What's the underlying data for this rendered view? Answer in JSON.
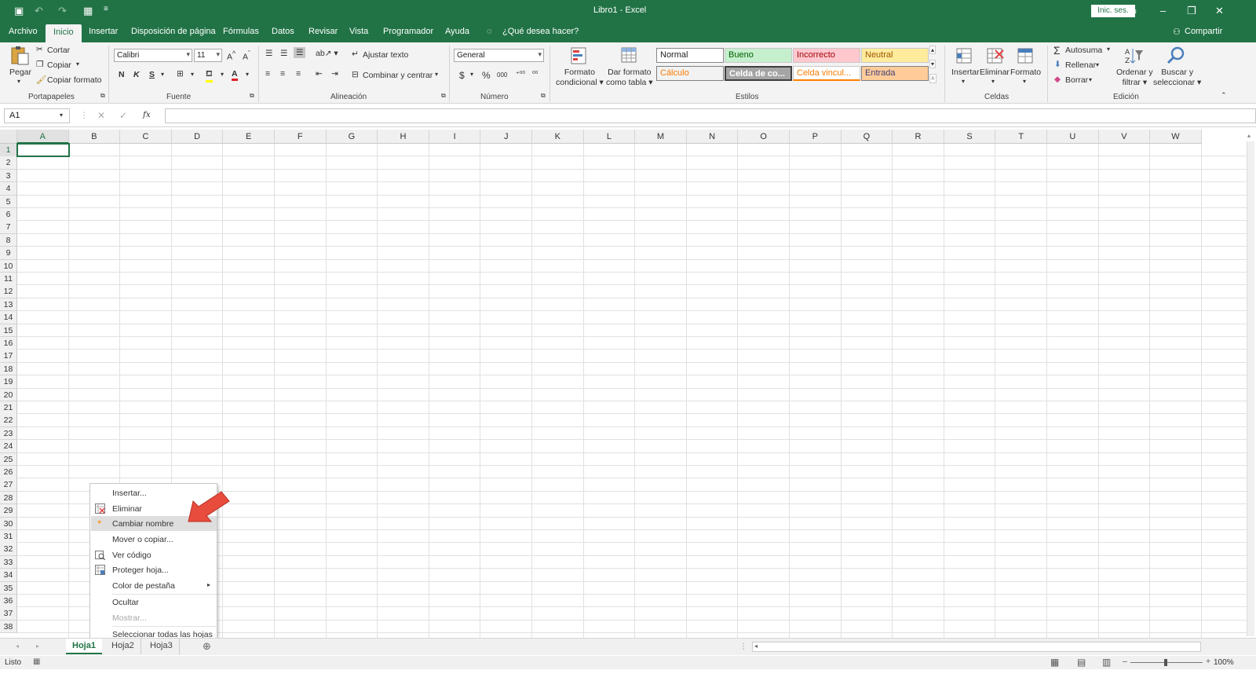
{
  "window": {
    "title": "Libro1  -  Excel",
    "signin": "Inic. ses."
  },
  "tabs": [
    "Archivo",
    "Inicio",
    "Insertar",
    "Disposición de página",
    "Fórmulas",
    "Datos",
    "Revisar",
    "Vista",
    "Programador",
    "Ayuda"
  ],
  "tell_me": "¿Qué desea hacer?",
  "share": "Compartir",
  "ribbon": {
    "clipboard": {
      "paste": "Pegar",
      "cut": "Cortar",
      "copy": "Copiar",
      "format_painter": "Copiar formato",
      "group": "Portapapeles"
    },
    "font": {
      "name": "Calibri",
      "size": "11",
      "bold": "N",
      "italic": "K",
      "underline": "S",
      "group": "Fuente"
    },
    "alignment": {
      "wrap": "Ajustar texto",
      "merge": "Combinar y centrar",
      "group": "Alineación"
    },
    "number": {
      "format": "General",
      "currency": "$",
      "percent": "%",
      "thousands": "000",
      "group": "Número"
    },
    "styles": {
      "conditional": "Formato condicional",
      "as_table": "Dar formato como tabla",
      "normal": "Normal",
      "good": "Bueno",
      "bad": "Incorrecto",
      "neutral": "Neutral",
      "calc": "Cálculo",
      "check": "Celda de co...",
      "linked": "Celda vincul...",
      "input": "Entrada",
      "group": "Estilos"
    },
    "cells": {
      "insert": "Insertar",
      "delete": "Eliminar",
      "format": "Formato",
      "group": "Celdas"
    },
    "editing": {
      "autosum": "Autosuma",
      "fill": "Rellenar",
      "clear": "Borrar",
      "sort": "Ordenar y filtrar",
      "find": "Buscar y seleccionar",
      "group": "Edición"
    }
  },
  "formula_bar": {
    "name_box": "A1",
    "fx": "fx"
  },
  "columns": [
    "A",
    "B",
    "C",
    "D",
    "E",
    "F",
    "G",
    "H",
    "I",
    "J",
    "K",
    "L",
    "M",
    "N",
    "O",
    "P",
    "Q",
    "R",
    "S",
    "T",
    "U",
    "V",
    "W"
  ],
  "rows": [
    "1",
    "2",
    "3",
    "4",
    "5",
    "6",
    "7",
    "8",
    "9",
    "10",
    "11",
    "12",
    "13",
    "14",
    "15",
    "16",
    "17",
    "18",
    "19",
    "20",
    "21",
    "22",
    "23",
    "24",
    "25",
    "26",
    "27",
    "28",
    "29",
    "30",
    "31",
    "32",
    "33",
    "34",
    "35",
    "36",
    "37",
    "38"
  ],
  "context_menu": [
    "Insertar...",
    "Eliminar",
    "Cambiar nombre",
    "Mover o copiar...",
    "Ver código",
    "Proteger hoja...",
    "Color de pestaña",
    "Ocultar",
    "Mostrar...",
    "Seleccionar todas las hojas"
  ],
  "sheets": [
    "Hoja1",
    "Hoja2",
    "Hoja3"
  ],
  "status": {
    "ready": "Listo",
    "zoom": "100"
  },
  "colors": {
    "accent": "#217346",
    "arrow": "#e84c3d"
  }
}
